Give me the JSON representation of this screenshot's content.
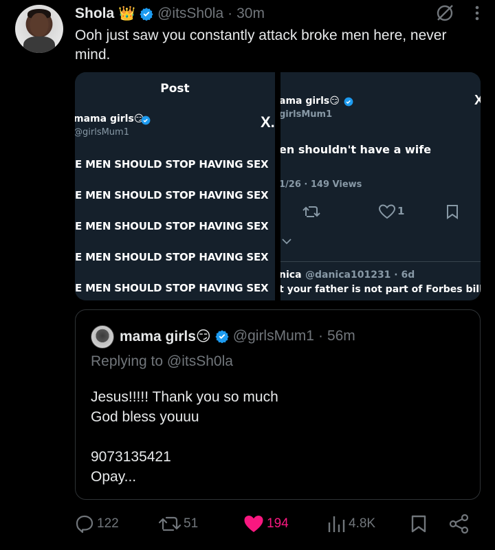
{
  "post": {
    "author_name": "Shola",
    "author_emoji": "👑",
    "handle": "@itsSh0la",
    "separator": "·",
    "time": "30m",
    "text": "Ooh just saw you constantly attack broke men here, never mind."
  },
  "media_left": {
    "title": "Post",
    "account_name": "mama girls😏",
    "account_handle": "@girlsMum1",
    "logo": "X.",
    "lines": [
      "E MEN SHOULD STOP HAVING SEX",
      "E MEN SHOULD STOP HAVING SEX",
      "E MEN SHOULD STOP HAVING SEX",
      "E MEN SHOULD STOP HAVING SEX",
      "E MEN SHOULD STOP HAVING SEX"
    ]
  },
  "media_right": {
    "account_name": "ama girls😏",
    "account_handle": "girlsMum1",
    "logo": "X",
    "text": "en shouldn't have a wife",
    "meta": "1/26 · 149 Views",
    "like_count": "1",
    "reply_name": "nica",
    "reply_handle": "@danica101231 · 6d",
    "reply_text": "t your father is not part of Forbes billio"
  },
  "quote": {
    "author_name": "mama girls😏",
    "handle": "@girlsMum1",
    "separator": "·",
    "time": "56m",
    "replying_to": "Replying to @itsSh0la",
    "lines": [
      "Jesus!!!!! Thank you so much",
      "God bless youuu",
      "",
      "9073135421",
      "Opay..."
    ]
  },
  "actions": {
    "replies": "122",
    "reposts": "51",
    "likes": "194",
    "views": "4.8K"
  },
  "colors": {
    "accent_blue": "#1d9bf0",
    "like_pink": "#f91880",
    "muted": "#71767b"
  }
}
